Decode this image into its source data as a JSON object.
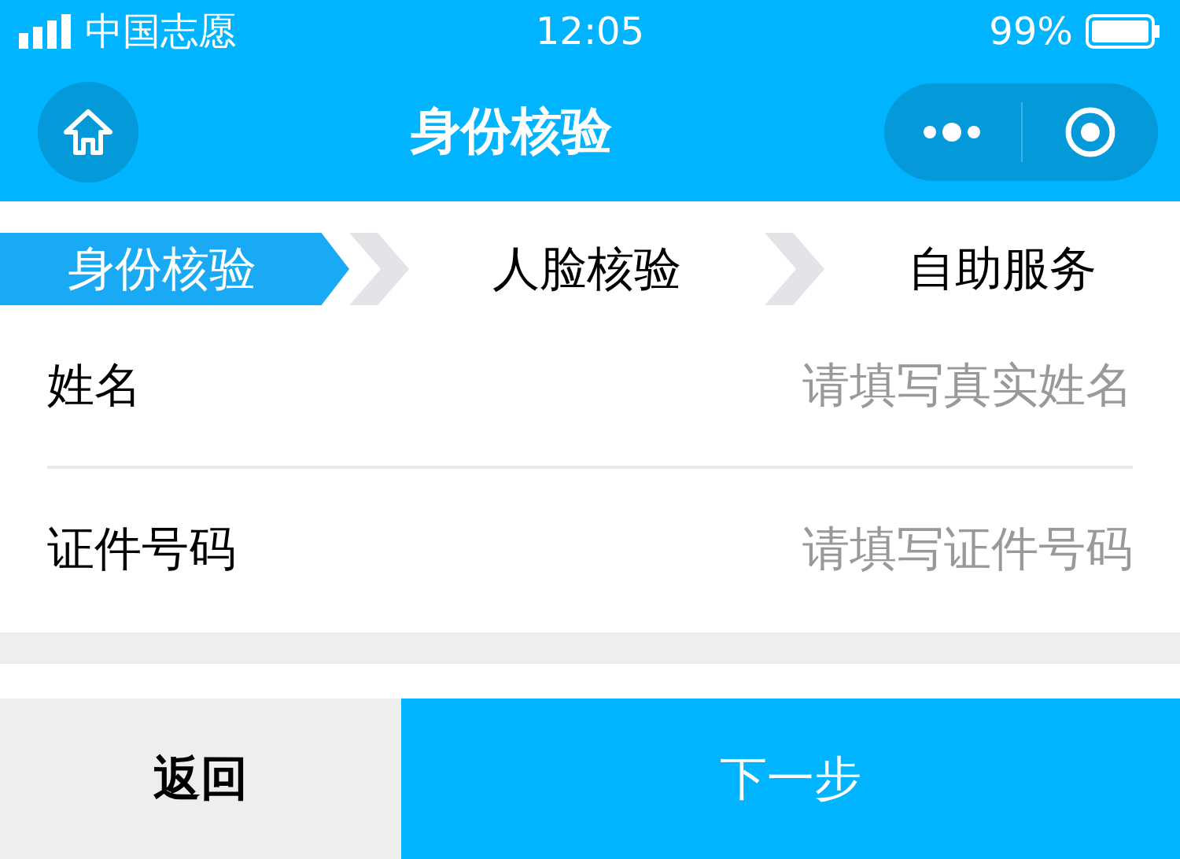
{
  "status_bar": {
    "carrier": "中国志愿",
    "time": "12:05",
    "battery": "99%"
  },
  "nav": {
    "title": "身份核验"
  },
  "steps": [
    {
      "label": "身份核验",
      "selected": true
    },
    {
      "label": "人脸核验",
      "selected": false
    },
    {
      "label": "自助服务",
      "selected": false
    }
  ],
  "fields": [
    {
      "label": "姓名",
      "placeholder": "请填写真实姓名"
    },
    {
      "label": "证件号码",
      "placeholder": "请填写证件号码"
    }
  ],
  "buttons": [
    {
      "label": "返回",
      "kind": "secondary"
    },
    {
      "label": "下一步",
      "kind": "primary"
    }
  ]
}
